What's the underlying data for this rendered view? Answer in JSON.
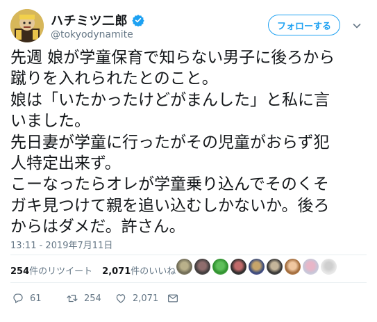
{
  "account": {
    "display_name": "ハチミツ二郎",
    "handle": "@tokyodynamite",
    "verified_icon": "verified-badge-icon"
  },
  "follow": {
    "label": "フォローする"
  },
  "tweet": {
    "lines": [
      "先週 娘が学童保育で知らない男子に後ろから",
      "蹴りを入れられたとのこと。",
      "娘は「いたかったけどがまんした」と私に言",
      "いました。",
      "先日妻が学童に行ったがその児童がおらず犯",
      "人特定出来ず。",
      "こーなったらオレが学童乗り込んでそのくそ",
      "ガキ見つけて親を追い込むしかないか。後ろ",
      "からはダメだ。許さん。"
    ],
    "timestamp": "13:11 - 2019年7月11日"
  },
  "stats": {
    "retweets_count": "254",
    "retweets_label": "件のリツイート",
    "likes_count": "2,071",
    "likes_label": "件のいいね"
  },
  "actions": {
    "reply_count": "61",
    "retweet_count": "254",
    "like_count": "2,071"
  },
  "colors": {
    "accent": "#1da1f2",
    "text": "#14171a",
    "muted": "#657786",
    "divider": "#e6ecf0"
  }
}
